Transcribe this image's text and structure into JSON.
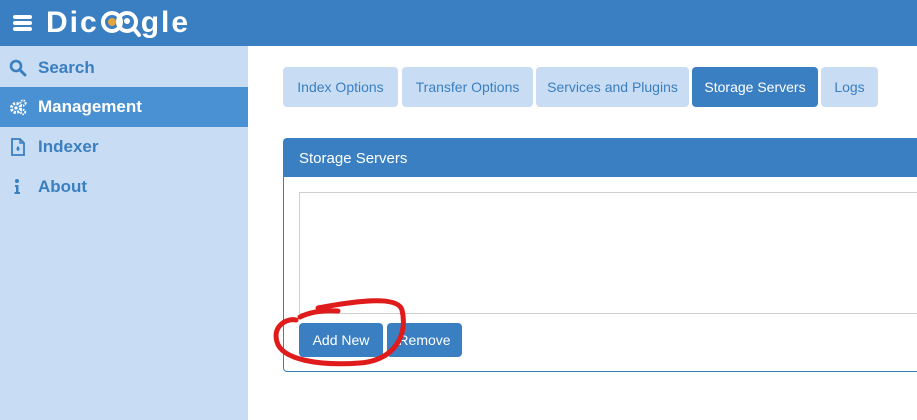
{
  "app": {
    "logo_text_left": "Dic",
    "logo_text_right": "gle"
  },
  "sidebar": {
    "items": [
      {
        "label": "Search",
        "icon": "search-icon"
      },
      {
        "label": "Management",
        "icon": "gears-icon",
        "active": true
      },
      {
        "label": "Indexer",
        "icon": "file-icon"
      },
      {
        "label": "About",
        "icon": "info-icon"
      }
    ]
  },
  "tabs": [
    {
      "label": "Index Options"
    },
    {
      "label": "Transfer Options"
    },
    {
      "label": "Services and Plugins"
    },
    {
      "label": "Storage Servers",
      "active": true
    },
    {
      "label": "Logs"
    }
  ],
  "panel": {
    "title": "Storage Servers",
    "add_label": "Add New",
    "remove_label": "Remove"
  },
  "colors": {
    "primary": "#3a7fc1",
    "sidebar_bg": "#c8ddf3",
    "active_nav": "#4a91d4",
    "annotation": "#e01b1b"
  }
}
